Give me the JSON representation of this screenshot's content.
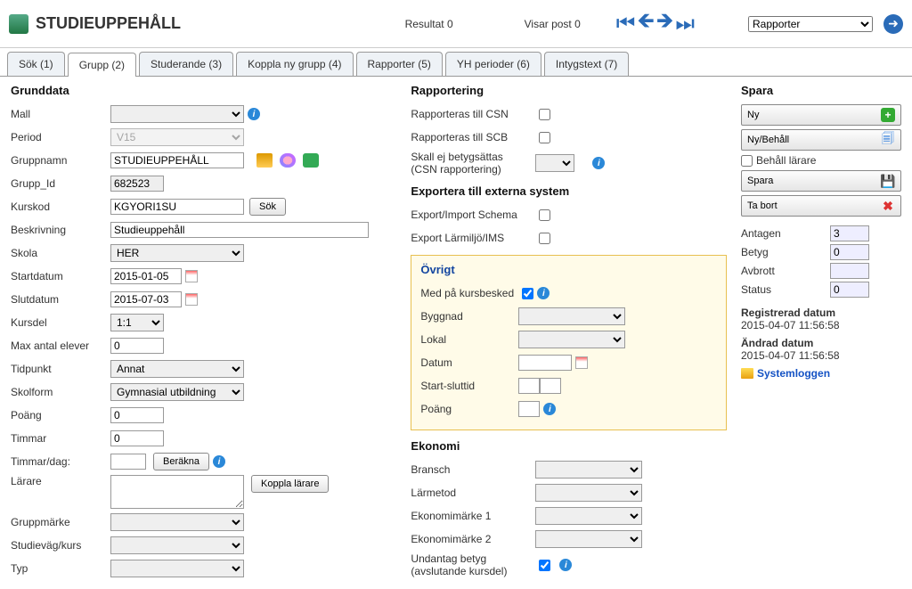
{
  "header": {
    "title": "STUDIEUPPEHÅLL",
    "resultat": "Resultat 0",
    "visar": "Visar post 0",
    "rapporter": "Rapporter"
  },
  "tabs": [
    "Sök (1)",
    "Grupp (2)",
    "Studerande (3)",
    "Koppla ny grupp (4)",
    "Rapporter (5)",
    "YH perioder (6)",
    "Intygstext (7)"
  ],
  "grund": {
    "title": "Grunddata",
    "mall": "Mall",
    "period": "Period",
    "period_val": "V15",
    "gruppnamn": "Gruppnamn",
    "gruppnamn_val": "STUDIEUPPEHÅLL",
    "gruppid": "Grupp_Id",
    "gruppid_val": "682523",
    "kurskod": "Kurskod",
    "kurskod_val": "KGYORI1SU",
    "sok": "Sök",
    "beskr": "Beskrivning",
    "beskr_val": "Studieuppehåll",
    "skola": "Skola",
    "skola_val": "HER",
    "start": "Startdatum",
    "start_val": "2015-01-05",
    "slut": "Slutdatum",
    "slut_val": "2015-07-03",
    "kursdel": "Kursdel",
    "kursdel_val": "1:1",
    "maxel": "Max antal elever",
    "maxel_val": "0",
    "tidpunkt": "Tidpunkt",
    "tidpunkt_val": "Annat",
    "skolform": "Skolform",
    "skolform_val": "Gymnasial utbildning",
    "poang": "Poäng",
    "poang_val": "0",
    "timmar": "Timmar",
    "timmar_val": "0",
    "timmardag": "Timmar/dag:",
    "berakna": "Beräkna",
    "larare": "Lärare",
    "koppla": "Koppla lärare",
    "gruppmarke": "Gruppmärke",
    "studievag": "Studieväg/kurs",
    "typ": "Typ"
  },
  "rapp": {
    "title": "Rapportering",
    "csn": "Rapporteras till CSN",
    "scb": "Rapporteras till SCB",
    "skall": "Skall ej betygsättas (CSN rapportering)",
    "skall1": "Skall ej betygsättas",
    "skall2": "(CSN rapportering)"
  },
  "exp": {
    "title": "Exportera till externa system",
    "schema": "Export/Import Schema",
    "ims": "Export Lärmiljö/IMS"
  },
  "ovr": {
    "title": "Övrigt",
    "med": "Med på kursbesked",
    "bygg": "Byggnad",
    "lokal": "Lokal",
    "datum": "Datum",
    "starttid": "Start-sluttid",
    "poang": "Poäng"
  },
  "eko": {
    "title": "Ekonomi",
    "bransch": "Bransch",
    "larmetod": "Lärmetod",
    "e1": "Ekonomimärke 1",
    "e2": "Ekonomimärke 2",
    "und1": "Undantag betyg",
    "und2": "(avslutande kursdel)"
  },
  "spara": {
    "title": "Spara",
    "ny": "Ny",
    "nybehall": "Ny/Behåll",
    "behall": "Behåll lärare",
    "spara": "Spara",
    "tabort": "Ta bort"
  },
  "stats": {
    "antagen": "Antagen",
    "antagen_val": "3",
    "betyg": "Betyg",
    "betyg_val": "0",
    "avbrott": "Avbrott",
    "status": "Status",
    "status_val": "0"
  },
  "ts": {
    "reg_t": "Registrerad datum",
    "reg_v": "2015-04-07 11:56:58",
    "and_t": "Ändrad datum",
    "and_v": "2015-04-07 11:56:58",
    "syslog": "Systemloggen"
  }
}
